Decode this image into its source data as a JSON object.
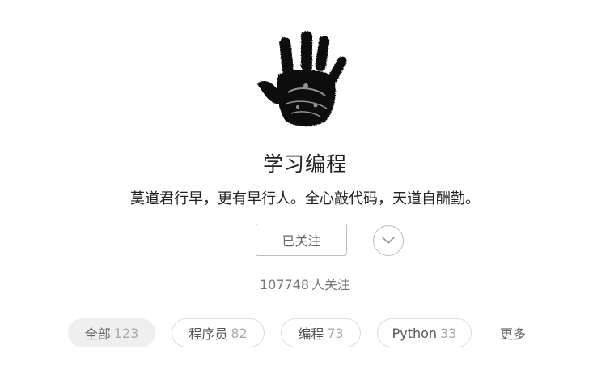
{
  "topic": {
    "title": "学习编程",
    "description": "莫道君行早，更有早行人。全心敲代码，天道自酬勤。",
    "icon": "hand-print-icon"
  },
  "actions": {
    "follow_label": "已关注",
    "expand_icon": "chevron-down-icon"
  },
  "followers": {
    "count": "107748",
    "label": "人关注"
  },
  "tags": [
    {
      "label": "全部",
      "count": "123",
      "active": true
    },
    {
      "label": "程序员",
      "count": "82",
      "active": false
    },
    {
      "label": "编程",
      "count": "73",
      "active": false
    },
    {
      "label": "Python",
      "count": "33",
      "active": false
    }
  ],
  "more_label": "更多",
  "colors": {
    "text": "#222222",
    "muted": "#777777",
    "border": "#dddddd",
    "active_tag_bg": "#efefef"
  }
}
